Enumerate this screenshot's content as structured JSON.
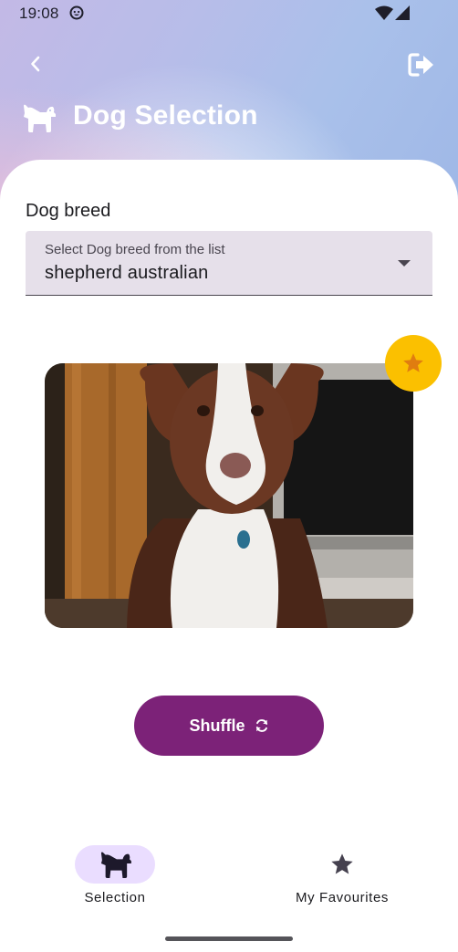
{
  "status_bar": {
    "time": "19:08"
  },
  "header": {
    "title": "Dog Selection",
    "back_icon": "chevron-left-icon",
    "logout_icon": "logout-arrow-icon",
    "logo_icon": "dog-icon"
  },
  "breed_field": {
    "label": "Dog breed",
    "hint": "Select Dog breed from the list",
    "value": "shepherd australian"
  },
  "photo": {
    "subject": "dog-photo"
  },
  "favourite_button": {
    "icon": "star-icon",
    "color": "#fbc000"
  },
  "shuffle_button": {
    "label": "Shuffle",
    "icon": "refresh-icon",
    "color": "#7c2278"
  },
  "nav": {
    "items": [
      {
        "label": "Selection",
        "icon": "dog-icon",
        "selected": true
      },
      {
        "label": "My Favourites",
        "icon": "star-icon",
        "selected": false
      }
    ]
  }
}
